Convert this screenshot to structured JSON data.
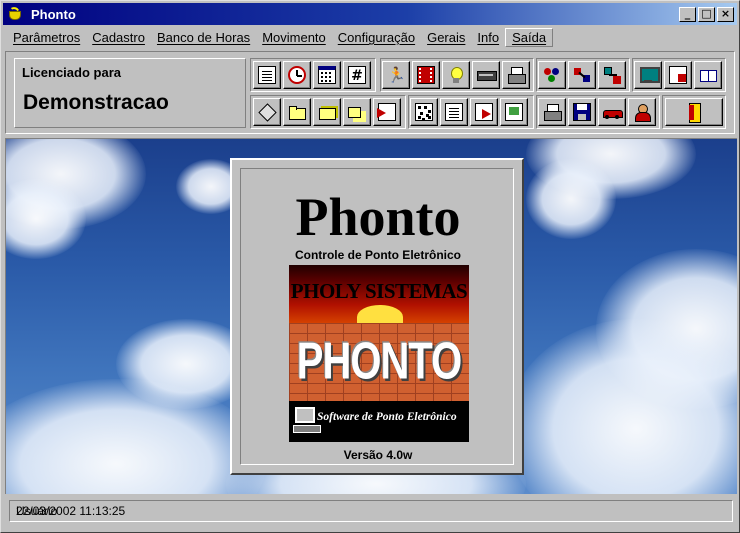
{
  "window": {
    "title": "Phonto",
    "buttons": {
      "minimize": "_",
      "maximize": "□",
      "close": "×"
    }
  },
  "menu": [
    {
      "label": "Parâmetros"
    },
    {
      "label": "Cadastro"
    },
    {
      "label": "Banco de Horas"
    },
    {
      "label": "Movimento"
    },
    {
      "label": "Configuração"
    },
    {
      "label": "Gerais"
    },
    {
      "label": "Info"
    },
    {
      "label": "Saída",
      "active": true
    }
  ],
  "license": {
    "label": "Licenciado para",
    "value": "Demonstracao"
  },
  "toolbar": {
    "row1": [
      "document-icon",
      "clock-icon",
      "calendar-icon",
      "hash-icon",
      "runner-icon",
      "film-icon",
      "bulb-icon",
      "card-icon",
      "printer-icon",
      "people-icon",
      "arrows-icon",
      "network-icon",
      "monitor-icon",
      "document-red-icon",
      "book-icon"
    ],
    "row2": [
      "tag-icon",
      "folder-icon",
      "folder-open-icon",
      "folders-icon",
      "import-icon",
      "grid-doc-icon",
      "edit-doc-icon",
      "export-icon",
      "report-icon",
      "print-doc-icon",
      "save-icon",
      "car-icon",
      "person-icon",
      "exit-icon"
    ],
    "hash_glyph": "#",
    "runner_glyph": "🏃"
  },
  "splash": {
    "title": "Phonto",
    "subtitle": "Controle de Ponto Eletrônico",
    "logo_company": "PHOLY SISTEMAS",
    "logo_product": "PHONTO",
    "logo_tagline": "Software de Ponto Eletrônico",
    "version": "Versão 4.0w"
  },
  "status": {
    "user_label": "Usuário",
    "datetime": "22/03/2002 11:13:25"
  }
}
